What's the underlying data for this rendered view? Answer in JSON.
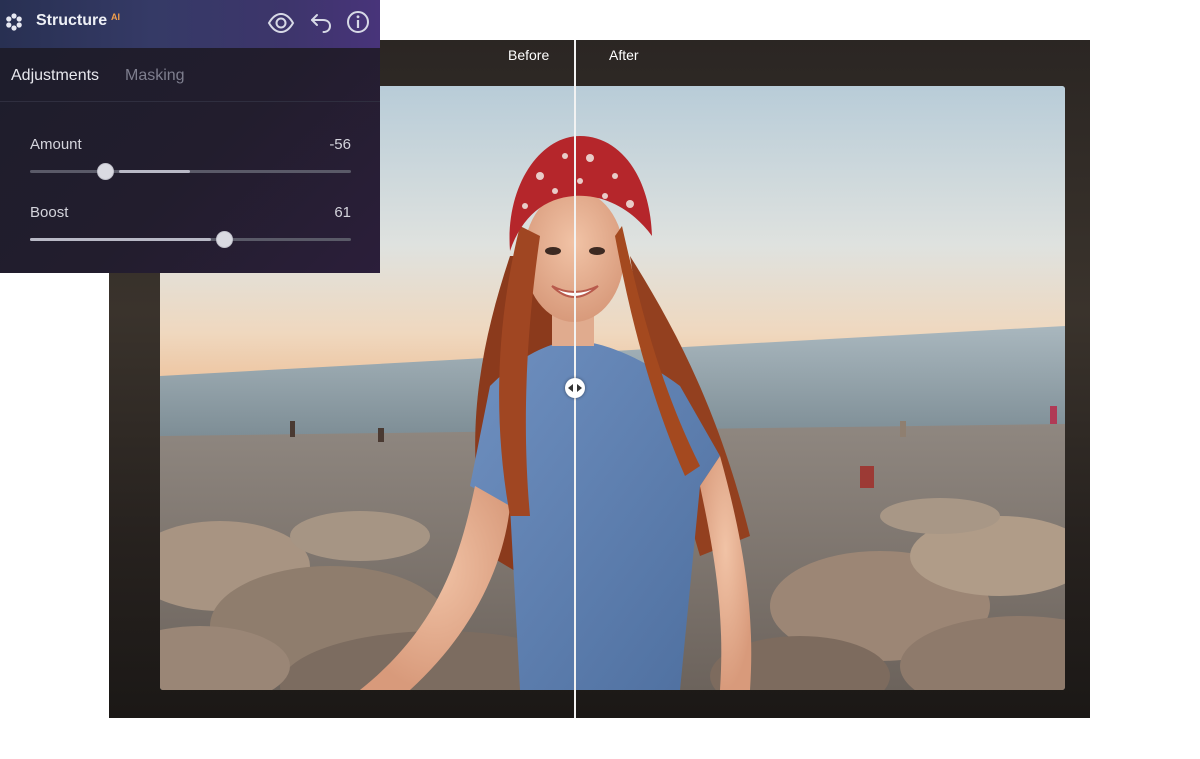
{
  "panel": {
    "title": "Structure",
    "title_badge": "AI",
    "icons": [
      "structure-icon",
      "eye-icon",
      "undo-icon",
      "info-icon"
    ],
    "tabs": [
      {
        "label": "Adjustments",
        "active": true
      },
      {
        "label": "Masking",
        "active": false
      }
    ],
    "sliders": {
      "amount": {
        "label": "Amount",
        "value": "-56",
        "min": -100,
        "max": 100
      },
      "boost": {
        "label": "Boost",
        "value": "61",
        "min": 0,
        "max": 100
      }
    }
  },
  "viewer": {
    "before_label": "Before",
    "after_label": "After"
  },
  "colors": {
    "accent_badge": "#f3a04d",
    "panel_header": "#353a66",
    "panel_body": "#1d1d2c"
  }
}
